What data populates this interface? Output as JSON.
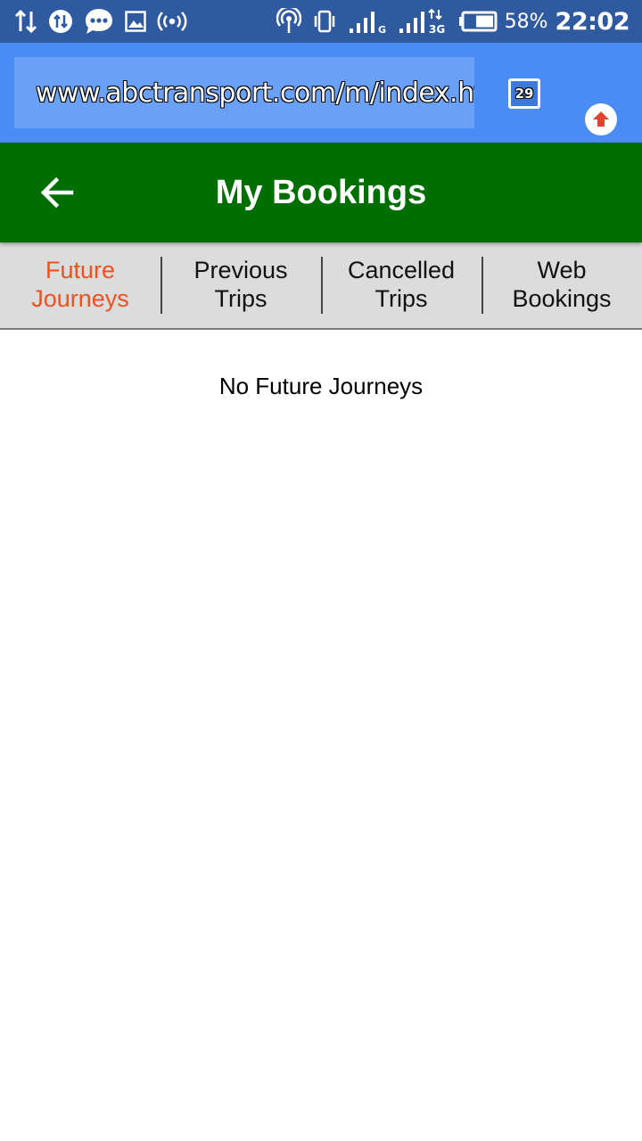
{
  "status_bar": {
    "icons_left": [
      "data-transfer-icon",
      "data-saver-icon",
      "messaging-icon",
      "image-icon",
      "hotspot-icon"
    ],
    "icons_right": [
      "nfc-icon",
      "vibrate-icon",
      "signal-icon",
      "signal-3g-icon",
      "battery-icon"
    ],
    "network_label_1": "G",
    "network_label_2": "3G",
    "battery_percent": "58%",
    "time": "22:02"
  },
  "browser": {
    "url": "www.abctransport.com/m/index.html",
    "tab_count": "29"
  },
  "header": {
    "title": "My Bookings"
  },
  "tabs": [
    {
      "line1": "Future",
      "line2": "Journeys",
      "active": true
    },
    {
      "line1": "Previous",
      "line2": "Trips",
      "active": false
    },
    {
      "line1": "Cancelled",
      "line2": "Trips",
      "active": false
    },
    {
      "line1": "Web",
      "line2": "Bookings",
      "active": false
    }
  ],
  "content": {
    "empty_message": "No Future Journeys"
  },
  "colors": {
    "status_bar": "#2f5aa0",
    "browser_bar": "#4a8cf4",
    "header": "#006e00",
    "tabs_bg": "#dcdcdc",
    "active_tab": "#f0501e"
  }
}
